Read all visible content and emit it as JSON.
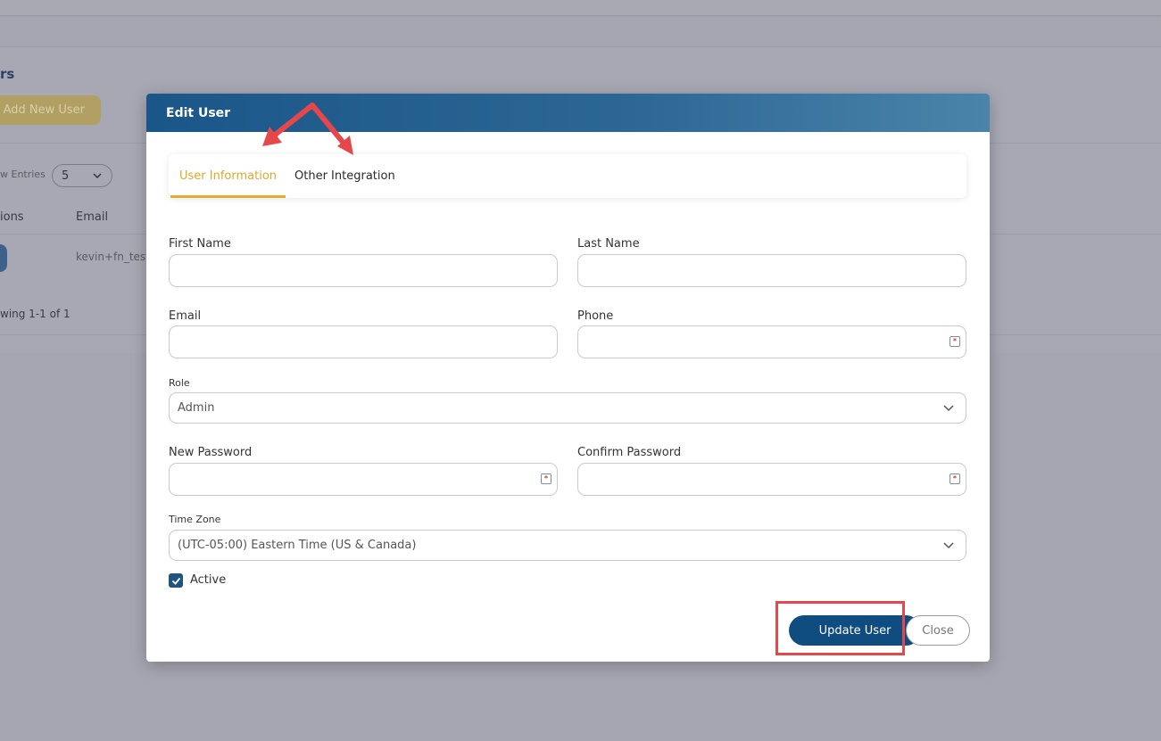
{
  "background": {
    "title_fragment": "rs",
    "add_button_label": "Add New User",
    "entries_label": "w Entries",
    "entries_value": "5",
    "columns": [
      "ions",
      "Email"
    ],
    "email_cell": "kevin+fn_test",
    "showing_text": "wing 1-1 of 1"
  },
  "modal": {
    "title": "Edit User",
    "tabs": [
      {
        "label": "User Information",
        "active": true
      },
      {
        "label": "Other Integration",
        "active": false
      }
    ],
    "fields": {
      "first_name": {
        "label": "First Name",
        "value": ""
      },
      "last_name": {
        "label": "Last Name",
        "value": ""
      },
      "email": {
        "label": "Email",
        "value": ""
      },
      "phone": {
        "label": "Phone",
        "value": ""
      },
      "role": {
        "label": "Role",
        "value": "Admin"
      },
      "new_password": {
        "label": "New Password",
        "value": ""
      },
      "confirm_password": {
        "label": "Confirm Password",
        "value": ""
      },
      "time_zone": {
        "label": "Time Zone",
        "value": "(UTC-05:00) Eastern Time (US & Canada)"
      }
    },
    "active": {
      "label": "Active",
      "checked": true
    },
    "buttons": {
      "update": "Update User",
      "close": "Close"
    }
  },
  "colors": {
    "header_start": "#1a5688",
    "header_end": "#4a84aa",
    "tab_active": "#e0a72b",
    "primary_button": "#0f4c7f",
    "annotation_red": "#e5474a"
  },
  "icons": {
    "chevron": "chevron-down-icon",
    "password_manager": "key-icon",
    "checkbox": "checkmark-icon"
  }
}
